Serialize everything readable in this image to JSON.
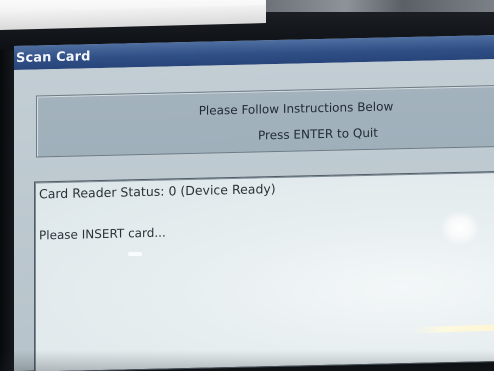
{
  "window": {
    "title": "Scan Card"
  },
  "instructions": {
    "line1": "Please Follow Instructions Below",
    "line2": "Press ENTER to Quit"
  },
  "log": {
    "status": "Card Reader Status: 0 (Device Ready)",
    "prompt": "Please INSERT card..."
  },
  "colors": {
    "titlebar": "#2f4f86",
    "window_body": "#c2cdd4",
    "instructions_panel": "#a3b2bd",
    "log_panel": "#e7eef0",
    "text": "#1f2a33"
  }
}
